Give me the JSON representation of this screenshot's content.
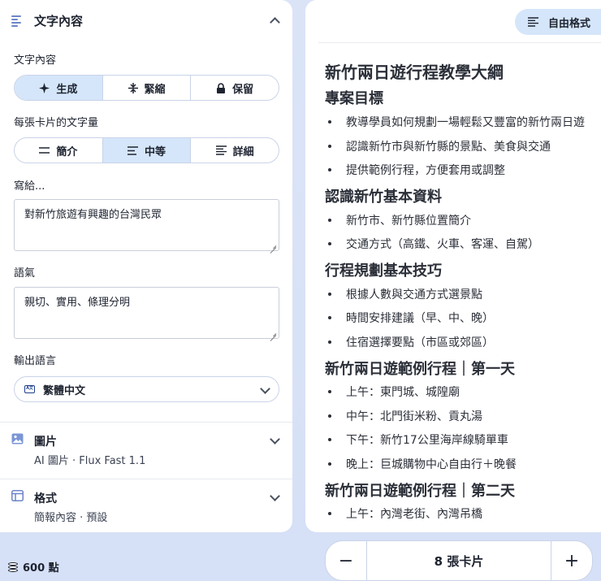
{
  "left": {
    "section_title": "文字內容",
    "text_content_label": "文字內容",
    "mode_options": [
      "生成",
      "緊縮",
      "保留"
    ],
    "amount_label": "每張卡片的文字量",
    "amount_options": [
      "簡介",
      "中等",
      "詳細"
    ],
    "audience_label": "寫給...",
    "audience_value": "對新竹旅遊有興趣的台灣民眾",
    "tone_label": "語氣",
    "tone_value": "親切、實用、條理分明",
    "language_label": "輸出語言",
    "language_value": "繁體中文",
    "language_icon_text": "A文",
    "images_title": "圖片",
    "images_sub": "AI 圖片 · Flux Fast 1.1",
    "format_title": "格式",
    "format_sub": "簡報內容 · 預設"
  },
  "footer": {
    "points": "600 點"
  },
  "right": {
    "style_button": "自由格式",
    "doc_title": "新竹兩日遊行程教學大綱",
    "sections": [
      {
        "heading": "專案目標",
        "items": [
          "教導學員如何規劃一場輕鬆又豐富的新竹兩日遊",
          "認識新竹市與新竹縣的景點、美食與交通",
          "提供範例行程，方便套用或調整"
        ]
      },
      {
        "heading": "認識新竹基本資料",
        "items": [
          "新竹市、新竹縣位置簡介",
          "交通方式（高鐵、火車、客運、自駕）"
        ]
      },
      {
        "heading": "行程規劃基本技巧",
        "items": [
          "根據人數與交通方式選景點",
          "時間安排建議（早、中、晚）",
          "住宿選擇要點（市區或郊區）"
        ]
      },
      {
        "heading": "新竹兩日遊範例行程｜第一天",
        "items": [
          "上午：東門城、城隍廟",
          "中午：北門街米粉、貢丸湯",
          "下午：新竹17公里海岸線騎單車",
          "晚上：巨城購物中心自由行＋晚餐"
        ]
      },
      {
        "heading": "新竹兩日遊範例行程｜第二天",
        "items": [
          "上午：內灣老街、內灣吊橋"
        ]
      }
    ]
  },
  "cards": {
    "minus": "−",
    "label": "8 張卡片",
    "plus": "+"
  },
  "colors": {
    "accent": "#d5e6fa",
    "icon_blue": "#6d86c8",
    "dark_blue": "#1f3f8c"
  }
}
